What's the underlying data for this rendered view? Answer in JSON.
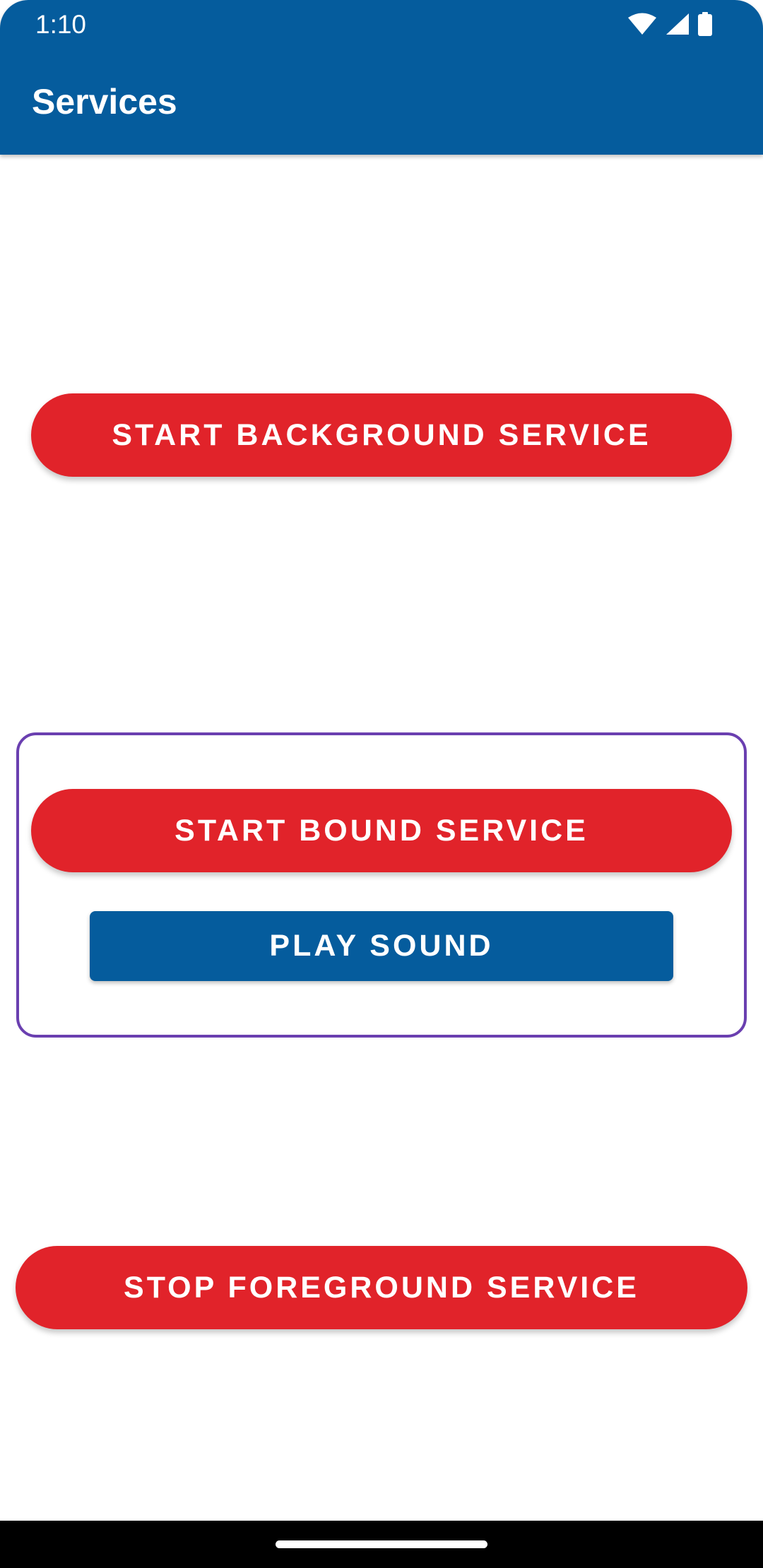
{
  "status_bar": {
    "time": "1:10",
    "icons": [
      "wifi-icon",
      "signal-icon",
      "battery-icon"
    ]
  },
  "app_bar": {
    "title": "Services"
  },
  "buttons": {
    "start_background": "START BACKGROUND SERVICE",
    "start_bound": "START BOUND SERVICE",
    "play_sound": "PLAY SOUND",
    "stop_foreground": "STOP FOREGROUND SERVICE"
  },
  "colors": {
    "primary": "#055C9D",
    "accent_red": "#E1232A",
    "group_border": "#6A3FB0",
    "background": "#FFFFFF"
  }
}
